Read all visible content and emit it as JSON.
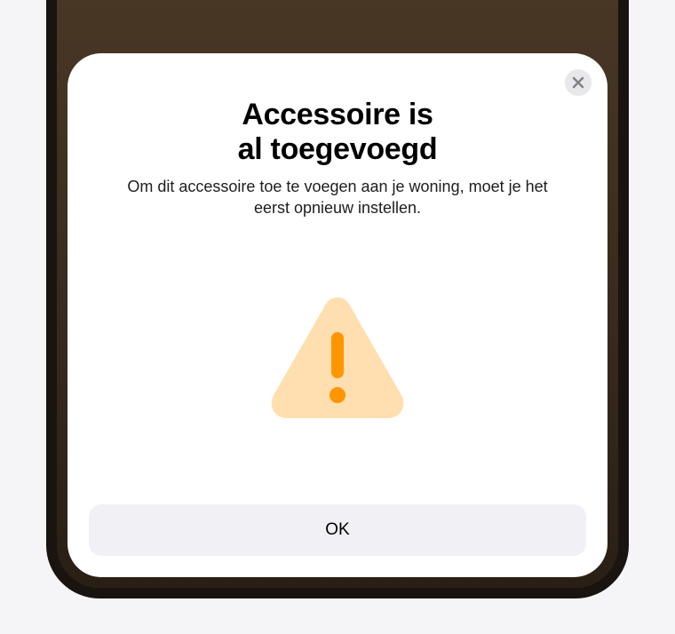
{
  "dialog": {
    "title_line1": "Accessoire is",
    "title_line2": "al toegevoegd",
    "message": "Om dit accessoire toe te voegen aan je woning, moet je het eerst opnieuw instellen.",
    "ok_label": "OK"
  },
  "colors": {
    "warning_triangle_fill": "#ffdfb0",
    "warning_exclamation": "#ff9500"
  }
}
